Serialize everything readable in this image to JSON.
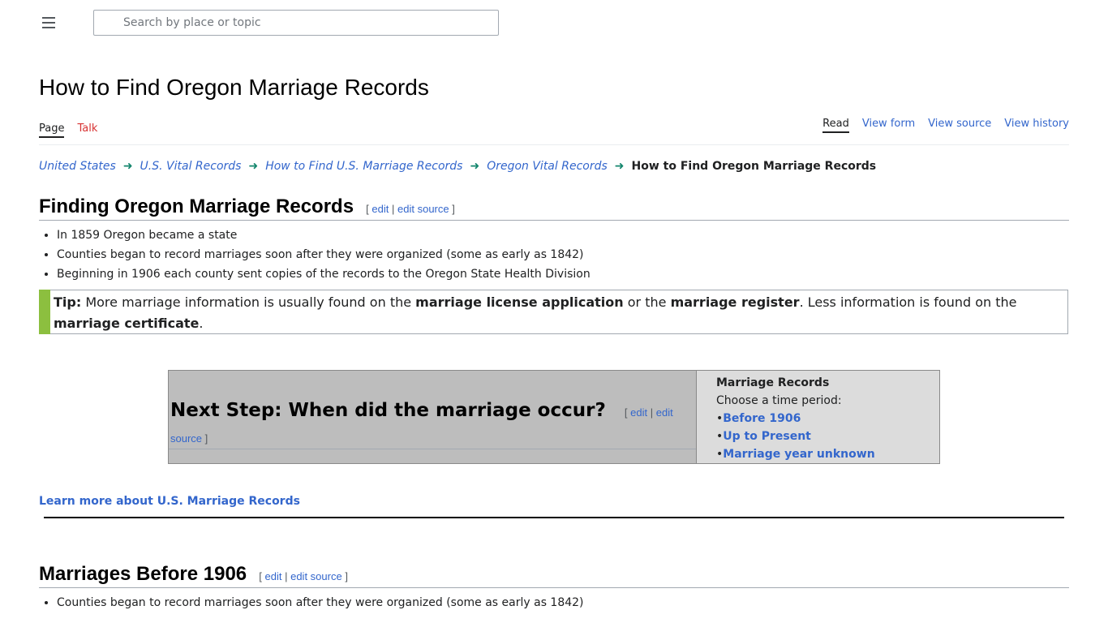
{
  "header": {
    "search_placeholder": "Search by place or topic"
  },
  "page": {
    "title": "How to Find Oregon Marriage Records"
  },
  "tabs_left": [
    {
      "label": "Page"
    },
    {
      "label": "Talk"
    }
  ],
  "tabs_right": [
    {
      "label": "Read"
    },
    {
      "label": "View form"
    },
    {
      "label": "View source"
    },
    {
      "label": "View history"
    }
  ],
  "breadcrumb": {
    "items": [
      "United States",
      "U.S. Vital Records",
      "How to Find U.S. Marriage Records",
      "Oregon Vital Records"
    ],
    "current": "How to Find Oregon Marriage Records"
  },
  "edit_links": {
    "open": "[",
    "edit": "edit",
    "sep": "|",
    "edit_source": "edit source",
    "close": "]"
  },
  "section1": {
    "heading": "Finding Oregon Marriage Records",
    "bullets": [
      "In 1859 Oregon became a state",
      "Counties began to record marriages soon after they were organized (some as early as 1842)",
      "Beginning in 1906 each county sent copies of the records to the Oregon State Health Division"
    ]
  },
  "tip": {
    "label": "Tip:",
    "text1": " More marriage information is usually found on the ",
    "bold1": "marriage license application",
    "text2": " or the ",
    "bold2": "marriage register",
    "text3": ". Less information is found on the ",
    "bold3": "marriage certificate",
    "text4": "."
  },
  "next_step": {
    "heading": "Next Step: When did the marriage occur?",
    "side_title": "Marriage Records",
    "side_subtitle": "Choose a time period:",
    "bullet": "•",
    "options": [
      "Before 1906",
      "Up to Present",
      "Marriage year unknown"
    ]
  },
  "learn_more": "Learn more about U.S. Marriage Records",
  "section2": {
    "heading": "Marriages Before 1906",
    "bullets": [
      "Counties began to record marriages soon after they were organized (some as early as 1842)"
    ]
  }
}
